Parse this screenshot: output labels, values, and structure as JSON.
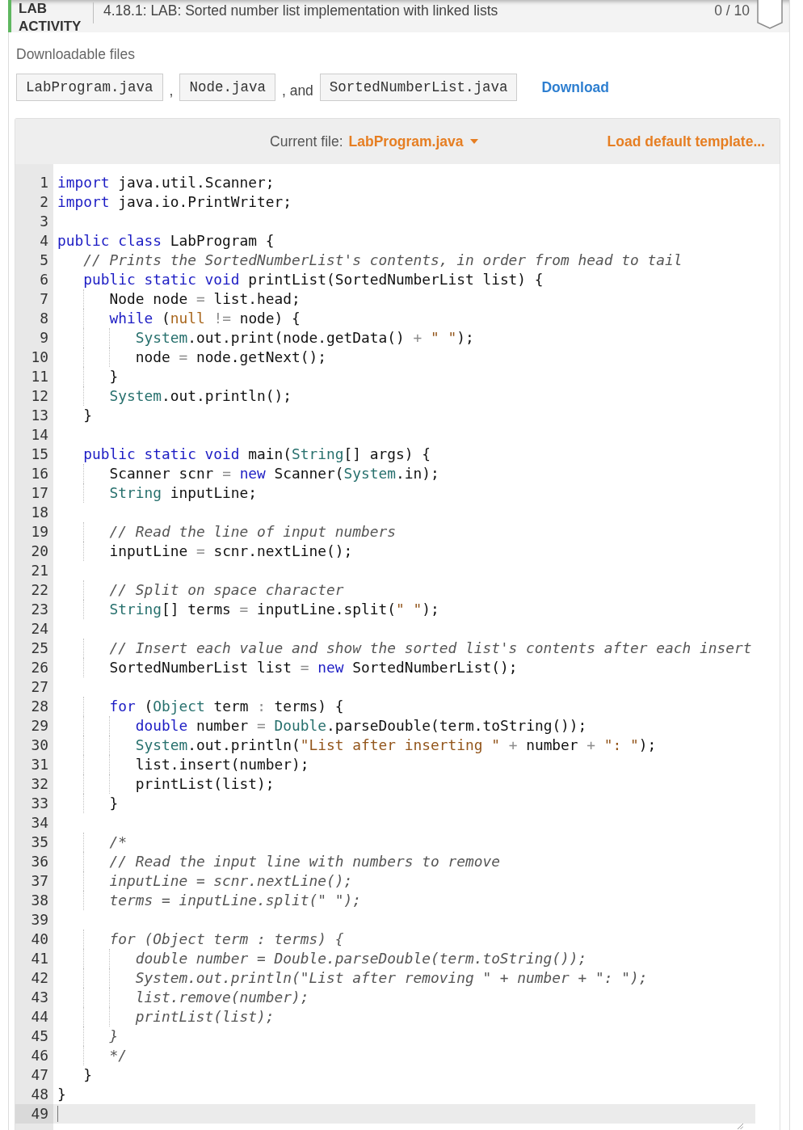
{
  "header": {
    "badge": "LAB ACTIVITY",
    "title": "4.18.1: LAB: Sorted number list implementation with linked lists",
    "score": "0 / 10"
  },
  "downloads": {
    "label": "Downloadable files",
    "items": [
      {
        "kind": "file",
        "text": "LabProgram.java"
      },
      {
        "kind": "separator",
        "text": ","
      },
      {
        "kind": "file",
        "text": "Node.java"
      },
      {
        "kind": "separator",
        "text": ", and"
      },
      {
        "kind": "file",
        "text": "SortedNumberList.java"
      }
    ],
    "link": "Download"
  },
  "editor": {
    "current_file_label": "Current file:",
    "current_file": "LabProgram.java",
    "load_template": "Load default template...",
    "lines": [
      {
        "number": "1",
        "current": false,
        "tokens": [
          {
            "kind": "keyword",
            "text": "import"
          },
          {
            "kind": "plain",
            "text": " java.util.Scanner;"
          }
        ]
      },
      {
        "number": "2",
        "current": false,
        "tokens": [
          {
            "kind": "keyword",
            "text": "import"
          },
          {
            "kind": "plain",
            "text": " java.io.PrintWriter;"
          }
        ]
      },
      {
        "number": "3",
        "current": false
      },
      {
        "number": "4",
        "current": false,
        "tokens": [
          {
            "kind": "keyword",
            "text": "public class"
          },
          {
            "kind": "plain",
            "text": " LabProgram {"
          }
        ]
      },
      {
        "number": "5",
        "current": false,
        "tokens": [
          {
            "kind": "comment",
            "text": "   // Prints the SortedNumberList's contents, in order from head to tail"
          }
        ]
      },
      {
        "number": "6",
        "current": false,
        "tokens": [
          {
            "kind": "keyword",
            "text": "   public static void"
          },
          {
            "kind": "plain",
            "text": " printList(SortedNumberList list) {"
          }
        ]
      },
      {
        "number": "7",
        "current": false,
        "tokens": [
          {
            "kind": "plain",
            "text": "      Node node "
          },
          {
            "kind": "operator",
            "text": "="
          },
          {
            "kind": "plain",
            "text": " list.head;"
          }
        ]
      },
      {
        "number": "8",
        "current": false,
        "tokens": [
          {
            "kind": "keyword",
            "text": "      while"
          },
          {
            "kind": "plain",
            "text": " ("
          },
          {
            "kind": "literal",
            "text": "null"
          },
          {
            "kind": "operator",
            "text": " !="
          },
          {
            "kind": "plain",
            "text": " node) {"
          }
        ]
      },
      {
        "number": "9",
        "current": false,
        "tokens": [
          {
            "kind": "type",
            "text": "         System"
          },
          {
            "kind": "plain",
            "text": ".out.print(node.getData() "
          },
          {
            "kind": "operator",
            "text": "+ "
          },
          {
            "kind": "string",
            "text": "\" \""
          },
          {
            "kind": "plain",
            "text": ");"
          }
        ]
      },
      {
        "number": "10",
        "current": false,
        "tokens": [
          {
            "kind": "plain",
            "text": "         node "
          },
          {
            "kind": "operator",
            "text": "="
          },
          {
            "kind": "plain",
            "text": " node.getNext();"
          }
        ]
      },
      {
        "number": "11",
        "current": false,
        "tokens": [
          {
            "kind": "plain",
            "text": "      }"
          }
        ]
      },
      {
        "number": "12",
        "current": false,
        "tokens": [
          {
            "kind": "type",
            "text": "      System"
          },
          {
            "kind": "plain",
            "text": ".out.println();"
          }
        ]
      },
      {
        "number": "13",
        "current": false,
        "tokens": [
          {
            "kind": "plain",
            "text": "   }"
          }
        ]
      },
      {
        "number": "14",
        "current": false
      },
      {
        "number": "15",
        "current": false,
        "tokens": [
          {
            "kind": "keyword",
            "text": "   public static void"
          },
          {
            "kind": "plain",
            "text": " main("
          },
          {
            "kind": "type",
            "text": "String"
          },
          {
            "kind": "plain",
            "text": "[] args) {"
          }
        ]
      },
      {
        "number": "16",
        "current": false,
        "tokens": [
          {
            "kind": "plain",
            "text": "      Scanner scnr "
          },
          {
            "kind": "operator",
            "text": "= "
          },
          {
            "kind": "keyword",
            "text": "new"
          },
          {
            "kind": "plain",
            "text": " Scanner("
          },
          {
            "kind": "type",
            "text": "System"
          },
          {
            "kind": "plain",
            "text": ".in);"
          }
        ]
      },
      {
        "number": "17",
        "current": false,
        "tokens": [
          {
            "kind": "type",
            "text": "      String"
          },
          {
            "kind": "plain",
            "text": " inputLine;"
          }
        ]
      },
      {
        "number": "18",
        "current": false
      },
      {
        "number": "19",
        "current": false,
        "tokens": [
          {
            "kind": "comment",
            "text": "      // Read the line of input numbers"
          }
        ]
      },
      {
        "number": "20",
        "current": false,
        "tokens": [
          {
            "kind": "plain",
            "text": "      inputLine "
          },
          {
            "kind": "operator",
            "text": "="
          },
          {
            "kind": "plain",
            "text": " scnr.nextLine();"
          }
        ]
      },
      {
        "number": "21",
        "current": false
      },
      {
        "number": "22",
        "current": false,
        "tokens": [
          {
            "kind": "comment",
            "text": "      // Split on space character"
          }
        ]
      },
      {
        "number": "23",
        "current": false,
        "tokens": [
          {
            "kind": "type",
            "text": "      String"
          },
          {
            "kind": "plain",
            "text": "[] terms "
          },
          {
            "kind": "operator",
            "text": "="
          },
          {
            "kind": "plain",
            "text": " inputLine.split("
          },
          {
            "kind": "string",
            "text": "\" \""
          },
          {
            "kind": "plain",
            "text": ");"
          }
        ]
      },
      {
        "number": "24",
        "current": false
      },
      {
        "number": "25",
        "current": false,
        "tokens": [
          {
            "kind": "comment",
            "text": "      // Insert each value and show the sorted list's contents after each insert"
          }
        ]
      },
      {
        "number": "26",
        "current": false,
        "tokens": [
          {
            "kind": "plain",
            "text": "      SortedNumberList list "
          },
          {
            "kind": "operator",
            "text": "= "
          },
          {
            "kind": "keyword",
            "text": "new"
          },
          {
            "kind": "plain",
            "text": " SortedNumberList();"
          }
        ]
      },
      {
        "number": "27",
        "current": false
      },
      {
        "number": "28",
        "current": false,
        "tokens": [
          {
            "kind": "keyword",
            "text": "      for"
          },
          {
            "kind": "plain",
            "text": " ("
          },
          {
            "kind": "type",
            "text": "Object"
          },
          {
            "kind": "plain",
            "text": " term "
          },
          {
            "kind": "operator",
            "text": ":"
          },
          {
            "kind": "plain",
            "text": " terms) {"
          }
        ]
      },
      {
        "number": "29",
        "current": false,
        "tokens": [
          {
            "kind": "keyword",
            "text": "         double"
          },
          {
            "kind": "plain",
            "text": " number "
          },
          {
            "kind": "operator",
            "text": "= "
          },
          {
            "kind": "type",
            "text": "Double"
          },
          {
            "kind": "plain",
            "text": ".parseDouble(term.toString());"
          }
        ]
      },
      {
        "number": "30",
        "current": false,
        "tokens": [
          {
            "kind": "type",
            "text": "         System"
          },
          {
            "kind": "plain",
            "text": ".out.println("
          },
          {
            "kind": "string",
            "text": "\"List after inserting \""
          },
          {
            "kind": "operator",
            "text": " + "
          },
          {
            "kind": "plain",
            "text": "number"
          },
          {
            "kind": "operator",
            "text": " + "
          },
          {
            "kind": "string",
            "text": "\": \""
          },
          {
            "kind": "plain",
            "text": ");"
          }
        ]
      },
      {
        "number": "31",
        "current": false,
        "tokens": [
          {
            "kind": "plain",
            "text": "         list.insert(number);"
          }
        ]
      },
      {
        "number": "32",
        "current": false,
        "tokens": [
          {
            "kind": "plain",
            "text": "         printList(list);"
          }
        ]
      },
      {
        "number": "33",
        "current": false,
        "tokens": [
          {
            "kind": "plain",
            "text": "      }"
          }
        ]
      },
      {
        "number": "34",
        "current": false
      },
      {
        "number": "35",
        "current": false,
        "tokens": [
          {
            "kind": "comment",
            "text": "      /*"
          }
        ]
      },
      {
        "number": "36",
        "current": false,
        "tokens": [
          {
            "kind": "comment",
            "text": "      // Read the input line with numbers to remove"
          }
        ]
      },
      {
        "number": "37",
        "current": false,
        "tokens": [
          {
            "kind": "comment",
            "text": "      inputLine = scnr.nextLine();"
          }
        ]
      },
      {
        "number": "38",
        "current": false,
        "tokens": [
          {
            "kind": "comment",
            "text": "      terms = inputLine.split(\" \");"
          }
        ]
      },
      {
        "number": "39",
        "current": false
      },
      {
        "number": "40",
        "current": false,
        "tokens": [
          {
            "kind": "comment",
            "text": "      for (Object term : terms) {"
          }
        ]
      },
      {
        "number": "41",
        "current": false,
        "tokens": [
          {
            "kind": "comment",
            "text": "         double number = Double.parseDouble(term.toString());"
          }
        ]
      },
      {
        "number": "42",
        "current": false,
        "tokens": [
          {
            "kind": "comment",
            "text": "         System.out.println(\"List after removing \" + number + \": \");"
          }
        ]
      },
      {
        "number": "43",
        "current": false,
        "tokens": [
          {
            "kind": "comment",
            "text": "         list.remove(number);"
          }
        ]
      },
      {
        "number": "44",
        "current": false,
        "tokens": [
          {
            "kind": "comment",
            "text": "         printList(list);"
          }
        ]
      },
      {
        "number": "45",
        "current": false,
        "tokens": [
          {
            "kind": "comment",
            "text": "      }"
          }
        ]
      },
      {
        "number": "46",
        "current": false,
        "tokens": [
          {
            "kind": "comment",
            "text": "      */"
          }
        ]
      },
      {
        "number": "47",
        "current": false,
        "tokens": [
          {
            "kind": "plain",
            "text": "   }"
          }
        ]
      },
      {
        "number": "48",
        "current": false,
        "tokens": [
          {
            "kind": "plain",
            "text": "}"
          }
        ]
      },
      {
        "number": "49",
        "current": true
      }
    ]
  }
}
